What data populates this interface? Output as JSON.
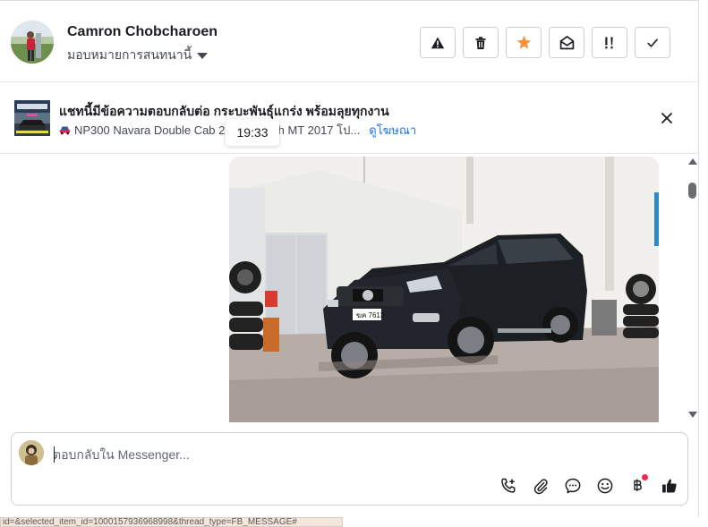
{
  "header": {
    "contact_name": "Camron Chobcharoen",
    "assign_label": "มอบหมายการสนทนานี้",
    "actions": [
      {
        "icon": "warning-icon",
        "label": "Spam"
      },
      {
        "icon": "trash-icon",
        "label": "Delete"
      },
      {
        "icon": "star-icon",
        "label": "Follow up"
      },
      {
        "icon": "envelope-open-icon",
        "label": "Mark as unread"
      },
      {
        "icon": "priority-icon",
        "label": "Priority"
      },
      {
        "icon": "check-icon",
        "label": "Done"
      }
    ]
  },
  "ad": {
    "title": "แชทนี้มีข้อความตอบกลับต่อ กระบะพันธุ์แกร่ง พร้อมลุยทุกงาน",
    "subtitle": "NP300 Navara Double Cab 2.5 Sportech MT 2017 โป...",
    "link": "ดูโฆษณา"
  },
  "tooltip": {
    "time": "19:33"
  },
  "message": {
    "photo_plate": "ฆค 7613"
  },
  "composer": {
    "placeholder": "ตอบกลับใน Messenger...",
    "tools": [
      "phone-plus-icon",
      "paperclip-icon",
      "chat-bubble-icon",
      "smile-icon",
      "baht-icon",
      "thumbs-up-icon"
    ]
  },
  "status_bar": {
    "url": "id=&selected_item_id=1000157936968998&thread_type=FB_MESSAGE#"
  },
  "colors": {
    "star": "#f7923a",
    "link": "#1877f2",
    "notification_dot": "#f02849",
    "border": "#ccd0d5"
  }
}
